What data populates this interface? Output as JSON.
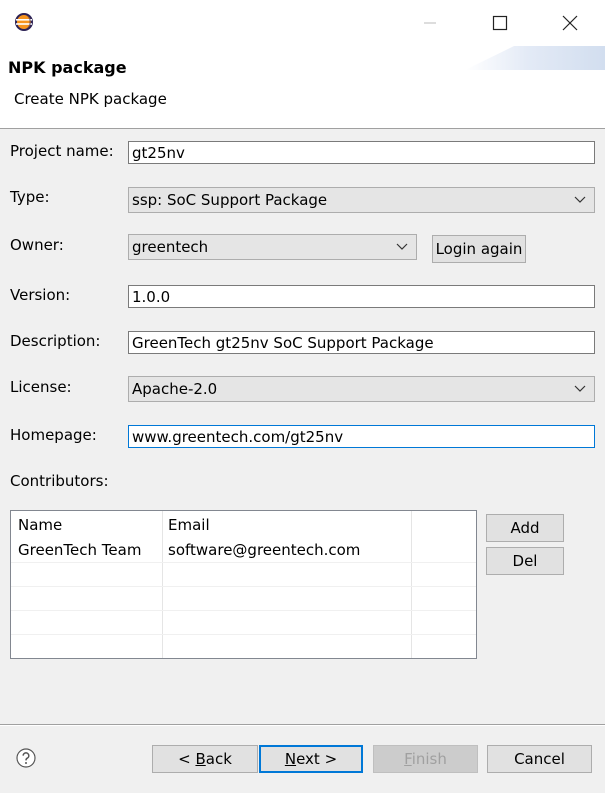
{
  "window": {
    "icon": "eclipse-icon",
    "controls": [
      "minimize-icon",
      "maximize-icon",
      "close-icon"
    ]
  },
  "header": {
    "title": "NPK package",
    "description": "Create NPK package"
  },
  "form": {
    "project_name": {
      "label": "Project name:",
      "value": "gt25nv"
    },
    "type": {
      "label": "Type:",
      "value": "ssp: SoC Support Package"
    },
    "owner": {
      "label": "Owner:",
      "value": "greentech",
      "login_label": "Login again"
    },
    "version": {
      "label": "Version:",
      "value": "1.0.0"
    },
    "description": {
      "label": "Description:",
      "value": "GreenTech gt25nv SoC Support Package"
    },
    "license": {
      "label": "License:",
      "value": "Apache-2.0"
    },
    "homepage": {
      "label": "Homepage:",
      "value": "www.greentech.com/gt25nv"
    }
  },
  "contributors": {
    "label": "Contributors:",
    "columns": [
      "Name",
      "Email"
    ],
    "rows": [
      {
        "name": "GreenTech Team",
        "email": "software@greentech.com"
      }
    ],
    "add_label": "Add",
    "del_label": "Del"
  },
  "footer": {
    "help_icon": "help-icon",
    "back_text": "Back",
    "back_prefix": "< ",
    "back_mnemonic": "B",
    "back_rest": "ack",
    "next_mnemonic": "N",
    "next_rest": "ext >",
    "finish_mnemonic": "F",
    "finish_rest": "inish",
    "cancel_label": "Cancel"
  }
}
